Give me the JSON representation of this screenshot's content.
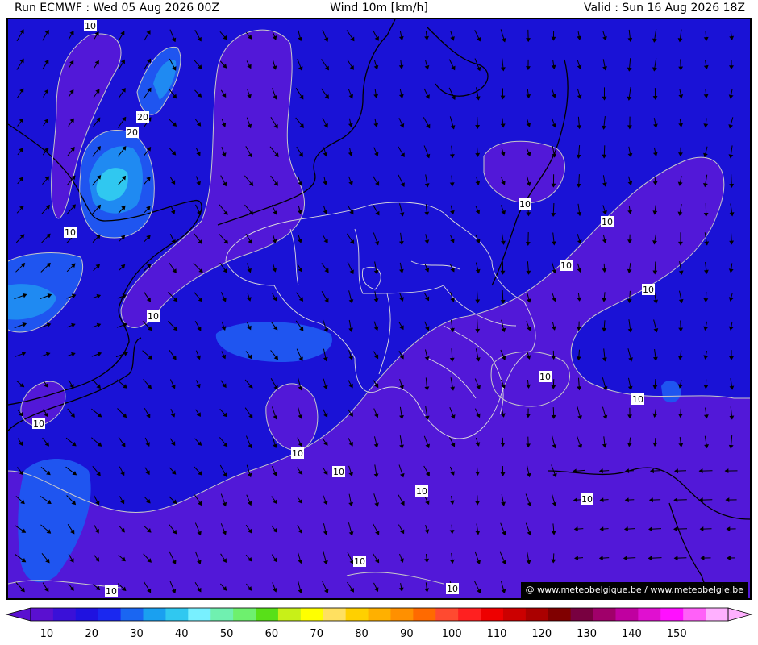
{
  "header": {
    "run": "Run ECMWF : Wed 05 Aug 2026 00Z",
    "title": "Wind 10m [km/h]",
    "valid": "Valid : Sun 16 Aug 2026 18Z"
  },
  "credit": "@ www.meteobelgique.be / www.meteobelgie.be",
  "colors": {
    "background_field": "#1a12d6",
    "below_10": "#2a10d8",
    "band_10_15": "#5218d8",
    "band_15_20": "#1f55f0",
    "band_20_25": "#1f8af2",
    "band_25_30": "#30c8f0",
    "contour": "#c8c8c8",
    "coast": "#000000",
    "border": "#dddddd"
  },
  "legend": {
    "ticks": [
      "10",
      "20",
      "30",
      "40",
      "50",
      "60",
      "70",
      "80",
      "90",
      "100",
      "110",
      "120",
      "130",
      "140",
      "150"
    ],
    "colors": [
      "#5a10d0",
      "#3a10d8",
      "#1f12e0",
      "#1a28f0",
      "#1a66f2",
      "#1aa0f0",
      "#30c8f0",
      "#78f0ff",
      "#70f0b0",
      "#6ef06e",
      "#58e018",
      "#c8f018",
      "#ffff00",
      "#ffe060",
      "#ffd000",
      "#ffb000",
      "#ff9000",
      "#ff6a00",
      "#ff4a30",
      "#ff2020",
      "#ee0000",
      "#cc0000",
      "#aa0000",
      "#800000",
      "#780040",
      "#a0006a",
      "#c000a0",
      "#e010d0",
      "#ff10ff",
      "#ff60f8",
      "#ffb0ff"
    ]
  },
  "contour_labels": [
    {
      "text": "10",
      "id": "c1"
    },
    {
      "text": "20",
      "id": "c2"
    },
    {
      "text": "20",
      "id": "c3"
    },
    {
      "text": "10",
      "id": "c4"
    },
    {
      "text": "10",
      "id": "c5"
    },
    {
      "text": "10",
      "id": "c6"
    },
    {
      "text": "10",
      "id": "c7"
    },
    {
      "text": "10",
      "id": "c8"
    },
    {
      "text": "10",
      "id": "c9"
    },
    {
      "text": "10",
      "id": "c10"
    },
    {
      "text": "10",
      "id": "c11"
    },
    {
      "text": "10",
      "id": "c12"
    },
    {
      "text": "10",
      "id": "c13"
    },
    {
      "text": "10",
      "id": "c14"
    },
    {
      "text": "10",
      "id": "c15"
    },
    {
      "text": "10",
      "id": "c16"
    },
    {
      "text": "10",
      "id": "c17"
    },
    {
      "text": "10",
      "id": "c18"
    },
    {
      "text": "10",
      "id": "c19"
    },
    {
      "text": "10",
      "id": "c20"
    }
  ]
}
